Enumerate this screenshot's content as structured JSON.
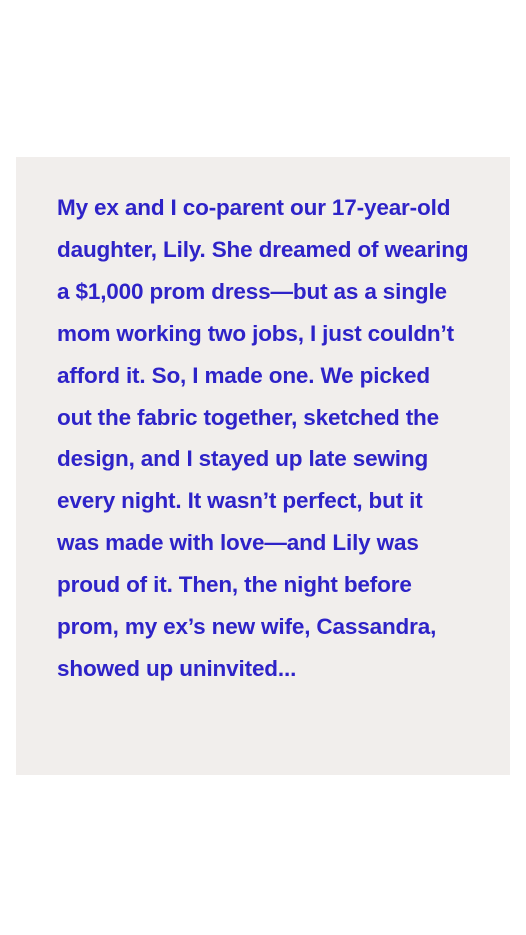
{
  "story": {
    "text": "My ex and I co-parent our 17-year-old daughter, Lily. She dreamed of wearing a $1,000 prom dress—but as a single mom working two jobs, I just couldn’t afford it. So, I made one. We picked out the fabric together, sketched the design, and I stayed up late sewing every night. It wasn’t perfect, but it was made with love—and Lily was proud of it. Then, the night before prom, my ex’s new wife, Cassandra, showed up uninvited..."
  },
  "colors": {
    "page_background": "#ffffff",
    "card_background": "#f1eeec",
    "text": "#2e23c8"
  }
}
